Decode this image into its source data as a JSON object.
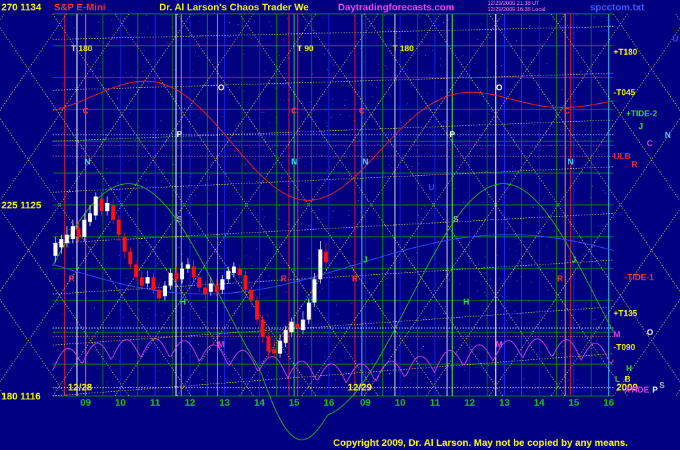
{
  "header": {
    "ylabel_top": "270  1134",
    "instrument": "S&P E-Mini",
    "title": "Dr. Al Larson's Chaos Trader We",
    "site": "Daytradingforecasts.com",
    "stamp1": "12/29/2009 21:38 UT",
    "stamp2": "12/29/2009 16:38 Local",
    "file": "spcctom.txt"
  },
  "footer": {
    "copyright": "Copyright 2009, Dr. Al Larson. May not be copied by any means."
  },
  "colors": {
    "background": "#000080",
    "grid_green": "#00a000",
    "grid_blue": "#1e2cff",
    "diag_yellow": "#e8e860",
    "price_up": "#ffffff",
    "price_down": "#ff1010",
    "red_line": "#ff2020",
    "green_line": "#20c020",
    "magenta_line": "#e040e0",
    "label_yellow": "#ffff00"
  },
  "chart_data": {
    "type": "line",
    "title": "S&P E-Mini",
    "ylim": [
      1116,
      1134
    ],
    "y_labels": [
      {
        "angle": "270",
        "price": "1134"
      },
      {
        "angle": "225",
        "price": "1125"
      },
      {
        "angle": "180",
        "price": "1116"
      }
    ],
    "x_ticks": [
      "09",
      "10",
      "11",
      "12",
      "13",
      "14",
      "15",
      "16",
      "09",
      "10",
      "11",
      "12",
      "13",
      "14",
      "15",
      "16"
    ],
    "day_labels": [
      "12/28",
      "12/29"
    ],
    "year_label": "2009",
    "hour_range": [
      8.05,
      16.1
    ],
    "price_bars": [
      {
        "t": 0,
        "o": 1122.6,
        "c": 1123.2,
        "h": 1123.5,
        "l": 1122.3
      },
      {
        "t": 1,
        "o": 1123.0,
        "c": 1123.4,
        "h": 1123.6,
        "l": 1122.7
      },
      {
        "t": 2,
        "o": 1123.2,
        "c": 1123.6,
        "h": 1124.0,
        "l": 1123.0
      },
      {
        "t": 3,
        "o": 1123.4,
        "c": 1124.0,
        "h": 1124.3,
        "l": 1123.2
      },
      {
        "t": 4,
        "o": 1123.9,
        "c": 1123.5,
        "h": 1124.2,
        "l": 1123.3
      },
      {
        "t": 5,
        "o": 1123.5,
        "c": 1124.3,
        "h": 1124.6,
        "l": 1123.3
      },
      {
        "t": 6,
        "o": 1124.2,
        "c": 1124.6,
        "h": 1125.0,
        "l": 1124.0
      },
      {
        "t": 7,
        "o": 1124.5,
        "c": 1125.4,
        "h": 1125.6,
        "l": 1124.3
      },
      {
        "t": 8,
        "o": 1125.3,
        "c": 1124.7,
        "h": 1125.6,
        "l": 1124.5
      },
      {
        "t": 9,
        "o": 1124.7,
        "c": 1125.1,
        "h": 1125.4,
        "l": 1124.5
      },
      {
        "t": 10,
        "o": 1125.0,
        "c": 1124.3,
        "h": 1125.3,
        "l": 1124.1
      },
      {
        "t": 11,
        "o": 1124.3,
        "c": 1123.6,
        "h": 1124.5,
        "l": 1123.3
      },
      {
        "t": 12,
        "o": 1123.5,
        "c": 1122.8,
        "h": 1123.7,
        "l": 1122.5
      },
      {
        "t": 13,
        "o": 1122.8,
        "c": 1122.2,
        "h": 1123.0,
        "l": 1122.0
      },
      {
        "t": 14,
        "o": 1122.2,
        "c": 1121.6,
        "h": 1122.4,
        "l": 1121.4
      },
      {
        "t": 15,
        "o": 1121.6,
        "c": 1121.2,
        "h": 1121.9,
        "l": 1121.0
      },
      {
        "t": 16,
        "o": 1121.3,
        "c": 1121.6,
        "h": 1121.9,
        "l": 1121.1
      },
      {
        "t": 17,
        "o": 1121.6,
        "c": 1121.0,
        "h": 1121.8,
        "l": 1120.8
      },
      {
        "t": 18,
        "o": 1121.0,
        "c": 1120.6,
        "h": 1121.3,
        "l": 1120.4
      },
      {
        "t": 19,
        "o": 1120.7,
        "c": 1121.2,
        "h": 1121.4,
        "l": 1120.5
      },
      {
        "t": 20,
        "o": 1121.2,
        "c": 1121.8,
        "h": 1122.0,
        "l": 1121.0
      },
      {
        "t": 21,
        "o": 1121.8,
        "c": 1121.5,
        "h": 1122.1,
        "l": 1121.3
      },
      {
        "t": 22,
        "o": 1121.5,
        "c": 1122.0,
        "h": 1122.3,
        "l": 1121.3
      },
      {
        "t": 23,
        "o": 1122.0,
        "c": 1122.2,
        "h": 1122.5,
        "l": 1121.8
      },
      {
        "t": 24,
        "o": 1122.1,
        "c": 1121.6,
        "h": 1122.4,
        "l": 1121.4
      },
      {
        "t": 25,
        "o": 1121.6,
        "c": 1121.1,
        "h": 1121.8,
        "l": 1120.9
      },
      {
        "t": 26,
        "o": 1121.1,
        "c": 1120.8,
        "h": 1121.4,
        "l": 1120.5
      },
      {
        "t": 27,
        "o": 1120.9,
        "c": 1121.3,
        "h": 1121.6,
        "l": 1120.7
      },
      {
        "t": 28,
        "o": 1121.2,
        "c": 1120.9,
        "h": 1121.5,
        "l": 1120.7
      },
      {
        "t": 29,
        "o": 1121.0,
        "c": 1121.5,
        "h": 1121.7,
        "l": 1120.8
      },
      {
        "t": 30,
        "o": 1121.5,
        "c": 1121.9,
        "h": 1122.1,
        "l": 1121.3
      },
      {
        "t": 31,
        "o": 1121.8,
        "c": 1122.1,
        "h": 1122.3,
        "l": 1121.6
      },
      {
        "t": 32,
        "o": 1122.0,
        "c": 1121.7,
        "h": 1122.2,
        "l": 1121.5
      },
      {
        "t": 33,
        "o": 1121.7,
        "c": 1121.0,
        "h": 1121.9,
        "l": 1120.8
      },
      {
        "t": 34,
        "o": 1121.0,
        "c": 1120.5,
        "h": 1121.2,
        "l": 1120.2
      },
      {
        "t": 35,
        "o": 1120.5,
        "c": 1119.6,
        "h": 1120.7,
        "l": 1119.4
      },
      {
        "t": 36,
        "o": 1119.6,
        "c": 1118.8,
        "h": 1119.8,
        "l": 1118.5
      },
      {
        "t": 37,
        "o": 1118.8,
        "c": 1118.1,
        "h": 1119.0,
        "l": 1117.8
      },
      {
        "t": 38,
        "o": 1118.2,
        "c": 1118.0,
        "h": 1118.7,
        "l": 1117.8
      },
      {
        "t": 39,
        "o": 1118.0,
        "c": 1118.6,
        "h": 1118.9,
        "l": 1117.8
      },
      {
        "t": 40,
        "o": 1118.5,
        "c": 1119.1,
        "h": 1119.3,
        "l": 1118.3
      },
      {
        "t": 41,
        "o": 1119.0,
        "c": 1119.5,
        "h": 1119.7,
        "l": 1118.8
      },
      {
        "t": 42,
        "o": 1119.4,
        "c": 1119.2,
        "h": 1119.8,
        "l": 1119.0
      },
      {
        "t": 43,
        "o": 1119.1,
        "c": 1119.6,
        "h": 1120.0,
        "l": 1118.9
      },
      {
        "t": 44,
        "o": 1119.6,
        "c": 1120.4,
        "h": 1120.6,
        "l": 1119.4
      },
      {
        "t": 45,
        "o": 1120.4,
        "c": 1121.5,
        "h": 1121.8,
        "l": 1120.2
      },
      {
        "t": 46,
        "o": 1121.5,
        "c": 1122.9,
        "h": 1123.3,
        "l": 1121.3
      },
      {
        "t": 47,
        "o": 1122.8,
        "c": 1122.3,
        "h": 1123.2,
        "l": 1122.0
      }
    ],
    "top_labels": [
      {
        "day": 0,
        "hour": 8.7,
        "text": "T  180"
      },
      {
        "day": 0,
        "hour": 15.2,
        "text": "T  90"
      },
      {
        "day": 1,
        "hour": 9.9,
        "text": "T  180"
      }
    ],
    "planet_labels": [
      {
        "day": 0,
        "hour": 9.0,
        "price": 1129.3,
        "text": "C",
        "color": "#ff3030"
      },
      {
        "day": 0,
        "hour": 9.05,
        "price": 1126.9,
        "text": "N",
        "color": "#40e0ff"
      },
      {
        "day": 0,
        "hour": 8.6,
        "price": 1121.4,
        "text": "R",
        "color": "#ff3030"
      },
      {
        "day": 0,
        "hour": 11.7,
        "price": 1128.2,
        "text": "P",
        "color": "#ffffff"
      },
      {
        "day": 0,
        "hour": 11.7,
        "price": 1124.2,
        "text": "S",
        "color": "#b0b0b0"
      },
      {
        "day": 0,
        "hour": 11.8,
        "price": 1120.3,
        "text": "H",
        "color": "#30e030"
      },
      {
        "day": 0,
        "hour": 12.9,
        "price": 1130.4,
        "text": "O",
        "color": "#ffffff"
      },
      {
        "day": 0,
        "hour": 12.9,
        "price": 1118.3,
        "text": "M",
        "color": "#e040e0"
      },
      {
        "day": 0,
        "hour": 15.0,
        "price": 1129.3,
        "text": "C",
        "color": "#ff3030"
      },
      {
        "day": 0,
        "hour": 15.0,
        "price": 1126.9,
        "text": "N",
        "color": "#40e0ff"
      },
      {
        "day": 0,
        "hour": 14.7,
        "price": 1121.4,
        "text": "R",
        "color": "#ff3030"
      },
      {
        "day": 1,
        "hour": 8.9,
        "price": 1129.3,
        "text": "C",
        "color": "#ff3030"
      },
      {
        "day": 1,
        "hour": 9.0,
        "price": 1126.9,
        "text": "N",
        "color": "#40e0ff"
      },
      {
        "day": 1,
        "hour": 8.7,
        "price": 1121.4,
        "text": "R",
        "color": "#ff3030"
      },
      {
        "day": 1,
        "hour": 9.0,
        "price": 1122.3,
        "text": "J",
        "color": "#30e030"
      },
      {
        "day": 1,
        "hour": 10.9,
        "price": 1125.7,
        "text": "U",
        "color": "#4040ff"
      },
      {
        "day": 1,
        "hour": 11.5,
        "price": 1128.2,
        "text": "P",
        "color": "#ffffff"
      },
      {
        "day": 1,
        "hour": 11.6,
        "price": 1124.2,
        "text": "S",
        "color": "#b0b0b0"
      },
      {
        "day": 1,
        "hour": 11.9,
        "price": 1120.3,
        "text": "H",
        "color": "#30e030"
      },
      {
        "day": 1,
        "hour": 12.85,
        "price": 1130.4,
        "text": "O",
        "color": "#ffffff"
      },
      {
        "day": 1,
        "hour": 12.85,
        "price": 1118.3,
        "text": "M",
        "color": "#e040e0"
      },
      {
        "day": 1,
        "hour": 14.8,
        "price": 1129.3,
        "text": "C",
        "color": "#ff3030"
      },
      {
        "day": 1,
        "hour": 14.9,
        "price": 1126.9,
        "text": "N",
        "color": "#40e0ff"
      },
      {
        "day": 1,
        "hour": 14.6,
        "price": 1121.4,
        "text": "R",
        "color": "#ff3030"
      },
      {
        "day": 1,
        "hour": 15.0,
        "price": 1122.3,
        "text": "J",
        "color": "#30e030"
      }
    ],
    "right_labels": [
      {
        "text": "+T180",
        "price": 1132.2,
        "color": "#ffff00",
        "offset": 0
      },
      {
        "text": "-T045",
        "price": 1130.3,
        "color": "#ffff00",
        "offset": 0
      },
      {
        "text": "+TIDE-2",
        "price": 1129.3,
        "color": "#30e030",
        "offset": 18
      },
      {
        "text": "J",
        "price": 1128.7,
        "color": "#30e030",
        "offset": 36
      },
      {
        "text": "N",
        "price": 1128.3,
        "color": "#40e0ff",
        "offset": 74
      },
      {
        "text": "C",
        "price": 1127.9,
        "color": "#e040e0",
        "offset": 48
      },
      {
        "text": "ULB",
        "price": 1127.3,
        "color": "#ff3030",
        "offset": 0
      },
      {
        "text": "R",
        "price": 1126.9,
        "color": "#ff3030",
        "offset": 26
      },
      {
        "text": "-TIDE-1",
        "price": 1121.6,
        "color": "#ff3030",
        "offset": 16
      },
      {
        "text": "+T135",
        "price": 1119.9,
        "color": "#ffff00",
        "offset": 0
      },
      {
        "text": "M",
        "price": 1118.9,
        "color": "#e040e0",
        "offset": 0
      },
      {
        "text": "O",
        "price": 1119.0,
        "color": "#ffffff",
        "offset": 48
      },
      {
        "text": "-T090",
        "price": 1118.3,
        "color": "#ffff00",
        "offset": 0
      },
      {
        "text": "H",
        "price": 1117.3,
        "color": "#30e030",
        "offset": 18
      },
      {
        "text": "L",
        "price": 1116.8,
        "color": "#30e030",
        "offset": 2
      },
      {
        "text": "B",
        "price": 1116.8,
        "color": "#ffff00",
        "offset": 16
      },
      {
        "text": "XTIDE",
        "price": 1116.3,
        "color": "#e040e0",
        "offset": 16
      },
      {
        "text": "P",
        "price": 1116.3,
        "color": "#ffffff",
        "offset": 56
      },
      {
        "text": "S",
        "price": 1116.5,
        "color": "#b0b0b0",
        "offset": 66
      }
    ],
    "corner_label": {
      "text": "U",
      "color": "#4040ff"
    },
    "grid": true
  }
}
